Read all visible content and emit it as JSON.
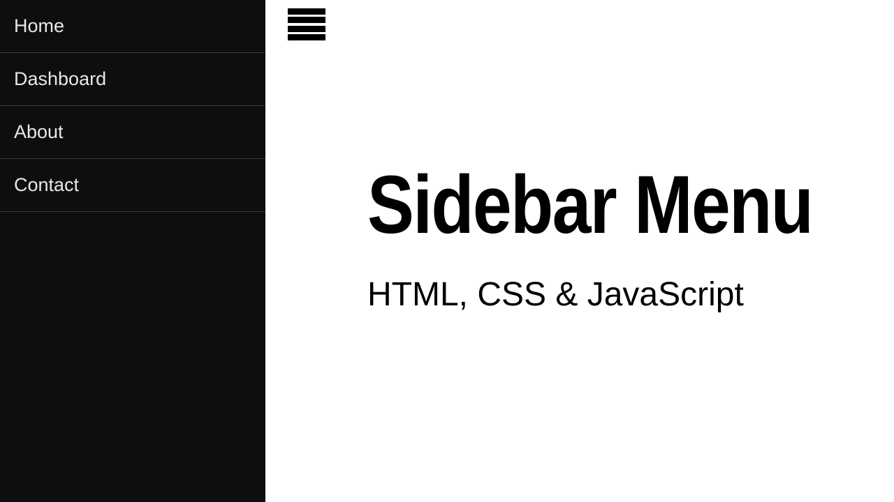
{
  "sidebar": {
    "items": [
      {
        "label": "Home"
      },
      {
        "label": "Dashboard"
      },
      {
        "label": "About"
      },
      {
        "label": "Contact"
      }
    ]
  },
  "main": {
    "title": "Sidebar Menu",
    "subtitle": "HTML, CSS & JavaScript"
  }
}
